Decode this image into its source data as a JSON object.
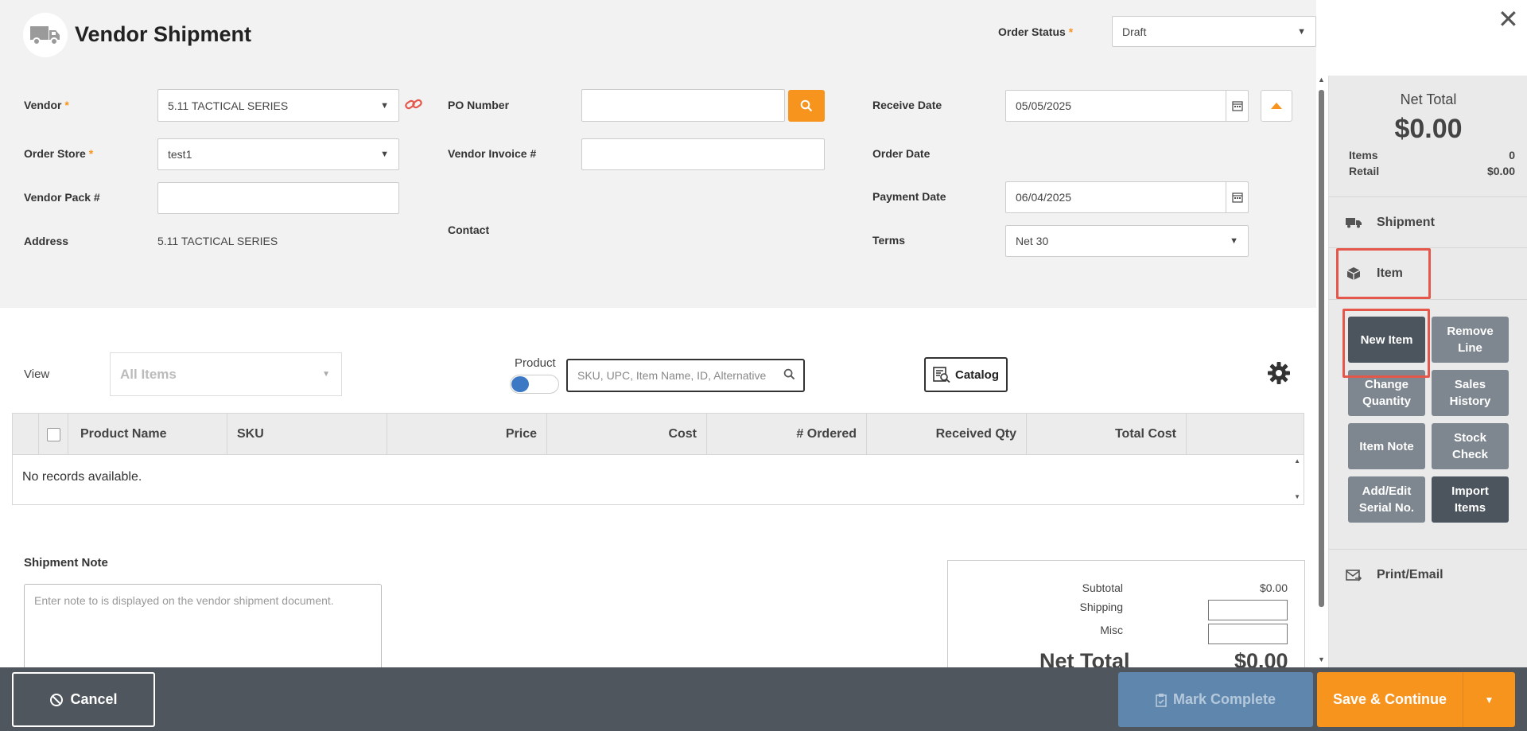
{
  "header": {
    "title": "Vendor Shipment",
    "order_status_label": "Order Status",
    "order_status_value": "Draft"
  },
  "form": {
    "vendor_label": "Vendor",
    "vendor_value": "5.11 TACTICAL SERIES",
    "order_store_label": "Order Store",
    "order_store_value": "test1",
    "vendor_pack_label": "Vendor Pack #",
    "vendor_pack_value": "",
    "address_label": "Address",
    "address_value": "5.11 TACTICAL SERIES",
    "po_number_label": "PO Number",
    "po_number_value": "",
    "vendor_invoice_label": "Vendor Invoice #",
    "vendor_invoice_value": "",
    "contact_label": "Contact",
    "receive_date_label": "Receive Date",
    "receive_date_value": "05/05/2025",
    "order_date_label": "Order Date",
    "payment_date_label": "Payment Date",
    "payment_date_value": "06/04/2025",
    "terms_label": "Terms",
    "terms_value": "Net 30",
    "required_mark": "*"
  },
  "sidebar": {
    "net_total_label": "Net Total",
    "net_total_value": "$0.00",
    "items_label": "Items",
    "items_value": "0",
    "retail_label": "Retail",
    "retail_value": "$0.00",
    "sections": {
      "shipment": "Shipment",
      "item": "Item",
      "print_email": "Print/Email"
    },
    "item_buttons": [
      "New Item",
      "Remove Line",
      "Change Quantity",
      "Sales History",
      "Item Note",
      "Stock Check",
      "Add/Edit Serial No.",
      "Import Items"
    ]
  },
  "toolbar": {
    "view_label": "View",
    "view_value": "All Items",
    "product_toggle_label": "Product",
    "search_placeholder": "SKU, UPC, Item Name, ID, Alternative",
    "catalog_label": "Catalog"
  },
  "grid": {
    "columns": [
      "Product Name",
      "SKU",
      "Price",
      "Cost",
      "# Ordered",
      "Received Qty",
      "Total Cost"
    ],
    "empty_text": "No records available."
  },
  "note": {
    "label": "Shipment Note",
    "placeholder": "Enter note to is displayed on the vendor shipment document."
  },
  "totals": {
    "subtotal_label": "Subtotal",
    "subtotal_value": "$0.00",
    "shipping_label": "Shipping",
    "misc_label": "Misc",
    "net_total_label": "Net Total",
    "net_total_value": "$0.00"
  },
  "footer": {
    "cancel_label": "Cancel",
    "mark_complete_label": "Mark Complete",
    "save_label": "Save & Continue"
  },
  "colors": {
    "accent": "#f7941d",
    "dark": "#4f565e",
    "highlight": "#e4574a",
    "toggle": "#3d78c4",
    "mark_complete": "#5f87ae"
  }
}
